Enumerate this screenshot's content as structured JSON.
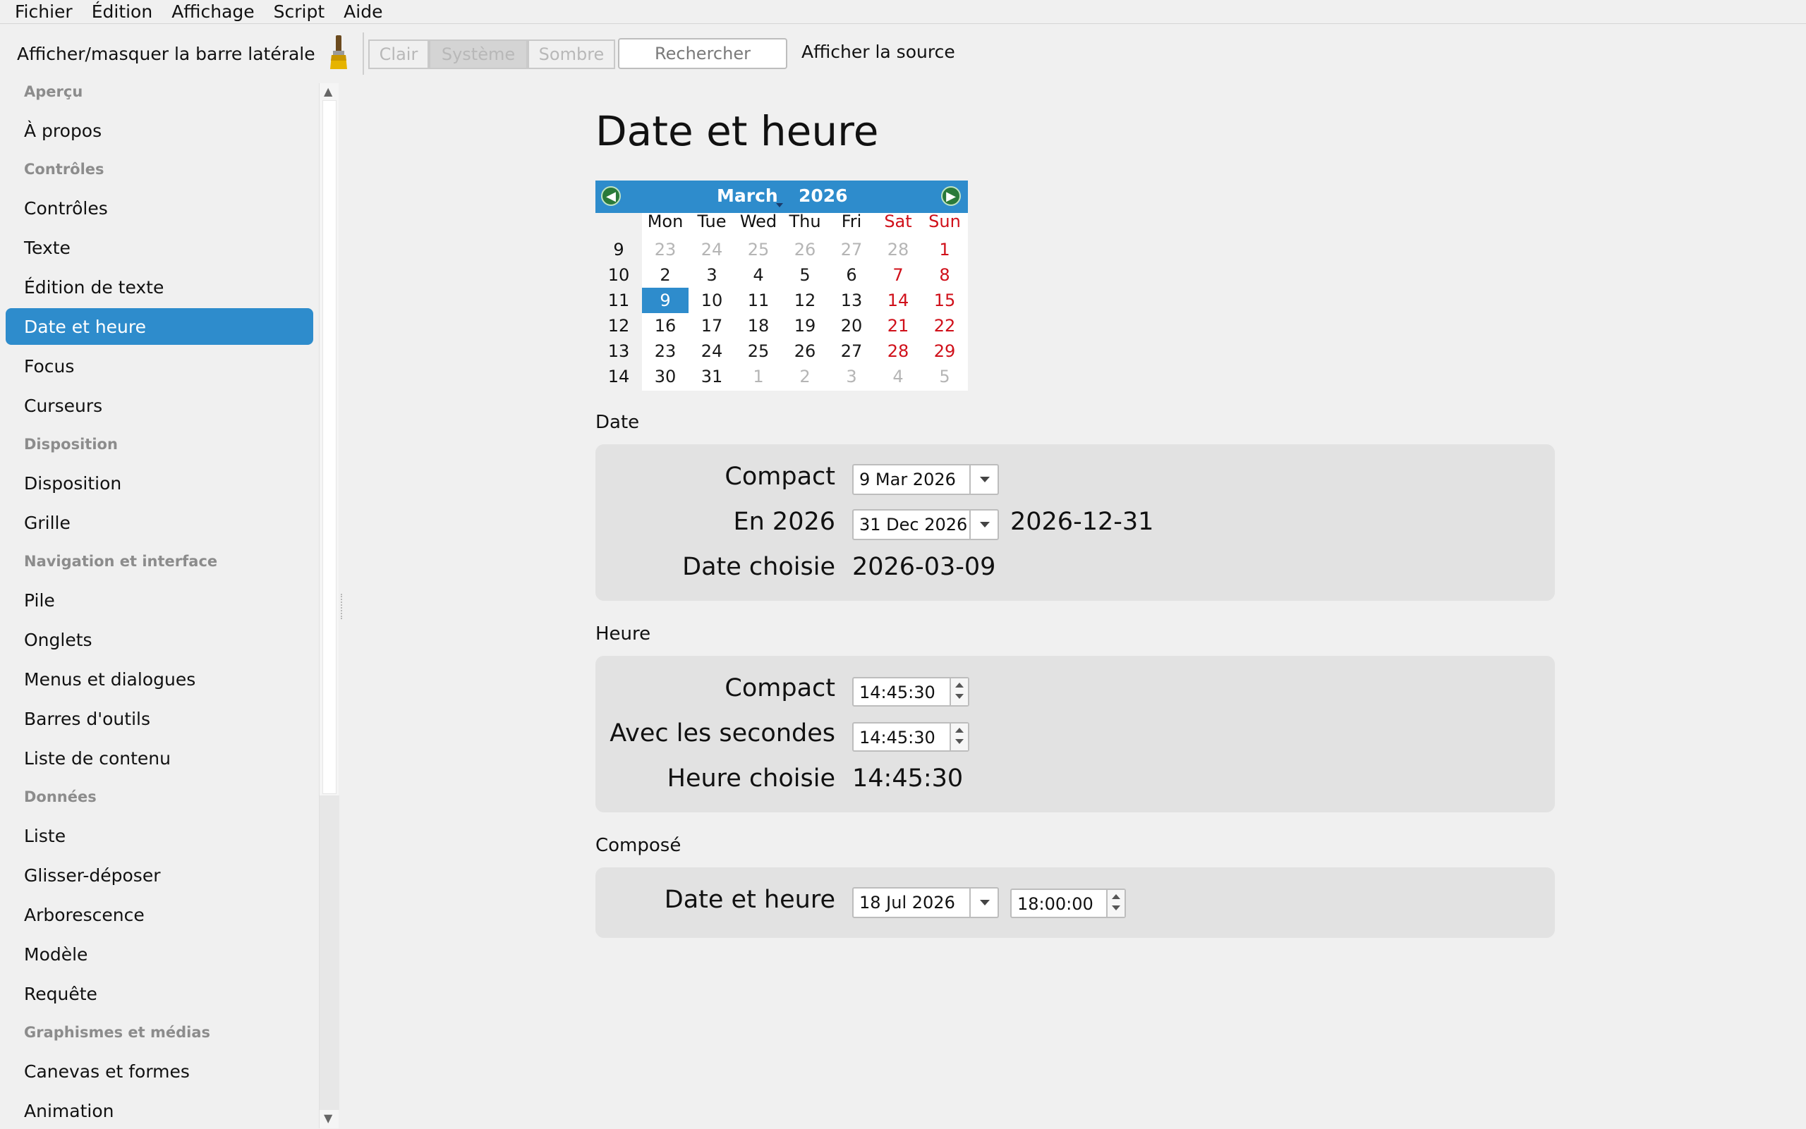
{
  "menubar": [
    "Fichier",
    "Édition",
    "Affichage",
    "Script",
    "Aide"
  ],
  "toolbar": {
    "toggle_sidebar": "Afficher/masquer la barre latérale",
    "theme_light": "Clair",
    "theme_system": "Système",
    "theme_dark": "Sombre",
    "search_placeholder": "Rechercher",
    "show_source": "Afficher la source",
    "selected_theme": "Système"
  },
  "sidebar": {
    "sections": [
      "Aperçu",
      "Contrôles",
      "Disposition",
      "Navigation et interface",
      "Données",
      "Graphismes et médias"
    ],
    "items": [
      "À propos",
      "Contrôles",
      "Texte",
      "Édition de texte",
      "Date et heure",
      "Focus",
      "Curseurs",
      "Disposition",
      "Grille",
      "Pile",
      "Onglets",
      "Menus et dialogues",
      "Barres d'outils",
      "Liste de contenu",
      "Liste",
      "Glisser-déposer",
      "Arborescence",
      "Modèle",
      "Requête",
      "Canevas et formes",
      "Animation"
    ],
    "active": "Date et heure"
  },
  "page": {
    "title": "Date et heure"
  },
  "calendar": {
    "month": "March",
    "year": "2026",
    "weekdays": [
      "Mon",
      "Tue",
      "Wed",
      "Thu",
      "Fri",
      "Sat",
      "Sun"
    ],
    "weeks": [
      {
        "wk": "9",
        "days": [
          "23",
          "24",
          "25",
          "26",
          "27",
          "28",
          "1"
        ]
      },
      {
        "wk": "10",
        "days": [
          "2",
          "3",
          "4",
          "5",
          "6",
          "7",
          "8"
        ]
      },
      {
        "wk": "11",
        "days": [
          "9",
          "10",
          "11",
          "12",
          "13",
          "14",
          "15"
        ]
      },
      {
        "wk": "12",
        "days": [
          "16",
          "17",
          "18",
          "19",
          "20",
          "21",
          "22"
        ]
      },
      {
        "wk": "13",
        "days": [
          "23",
          "24",
          "25",
          "26",
          "27",
          "28",
          "29"
        ]
      },
      {
        "wk": "14",
        "days": [
          "30",
          "31",
          "1",
          "2",
          "3",
          "4",
          "5"
        ]
      }
    ],
    "selected": "9",
    "weekend_color": "#d0101a",
    "accent_color": "#2e8ccc"
  },
  "date_section": {
    "label": "Date",
    "compact_label": "Compact",
    "compact_value": "9 Mar 2026",
    "year_label": "En 2026",
    "year_value": "31 Dec 2026",
    "year_iso": "2026-12-31",
    "chosen_label": "Date choisie",
    "chosen_value": "2026-03-09"
  },
  "time_section": {
    "label": "Heure",
    "compact_label": "Compact",
    "compact_value": "14:45:30",
    "seconds_label": "Avec les secondes",
    "seconds_value": "14:45:30",
    "chosen_label": "Heure choisie",
    "chosen_value": "14:45:30"
  },
  "composed_section": {
    "label": "Composé",
    "datetime_label": "Date et heure",
    "date_value": "18 Jul 2026",
    "time_value": "18:00:00"
  }
}
